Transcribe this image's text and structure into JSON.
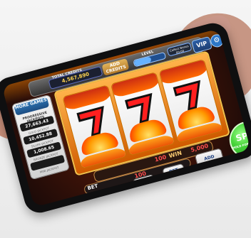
{
  "slot_ui": {
    "top": {
      "total_credits_label": "TOTAL CREDITS",
      "total_credits_value": "4,567,890",
      "add_credits_label": "ADD CREDITS",
      "level_label": "LEVEL",
      "level_progress": 0.55,
      "bonus_label": "Collect Bonus",
      "bonus_time": "00:00",
      "vip_label": "VIP",
      "settings_icon": "gear-icon"
    },
    "left_panel": {
      "more_games_label": "MORE GAMES",
      "progressive_label": "PROGRESSIVE JACKPOTS",
      "jackpots": [
        {
          "value": "27,663.43",
          "label": "GOLD JACKPOT"
        },
        {
          "value": "10,452.88",
          "label": "SILVER JACKPOT"
        },
        {
          "value": "1,008.65",
          "label": "BRONZE JACKPOT"
        },
        {
          "value": "",
          "label": "MINI JACKPOT"
        }
      ]
    },
    "win": {
      "win_value": "100",
      "win_label": "WIN",
      "win_amount": "5,000"
    },
    "bet": {
      "bet_label": "BET",
      "bet_value": "100"
    },
    "buttons": {
      "pays": "PAYS",
      "bet_less": "BET LESS",
      "bet_more": "BET MORE",
      "bet_max": "BET MAX",
      "add_credits": "ADD CREDITS",
      "spin": "SPIN",
      "spin_sub": "HOLD FOR AUTOSPIN"
    },
    "colors": {
      "accent_red": "#ff4f4f",
      "accent_gold": "#ffb34a",
      "spin_green": "#47d43a",
      "vip_blue": "#2c5ea5"
    }
  }
}
